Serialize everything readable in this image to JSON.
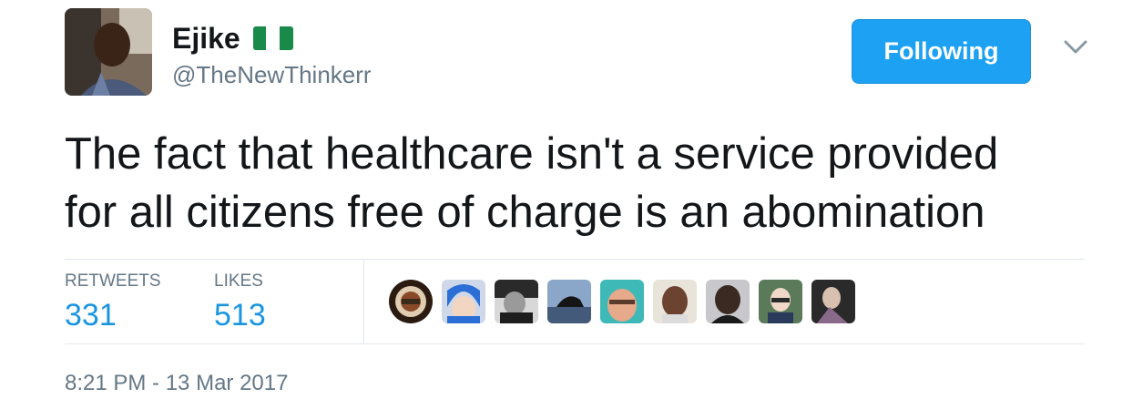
{
  "user": {
    "display_name": "Ejike",
    "handle": "@TheNewThinkerr",
    "flag_colors": [
      "#1a8a4a",
      "#ffffff",
      "#1a8a4a"
    ]
  },
  "follow_button": {
    "label": "Following",
    "color": "#1da1f2"
  },
  "tweet": {
    "text": "The fact that healthcare isn't a service provided\nfor all citizens free of charge is an abomination"
  },
  "stats": {
    "retweets_label": "RETWEETS",
    "retweets_count": "331",
    "likes_label": "LIKES",
    "likes_count": "513"
  },
  "likers_count_shown": 9,
  "timestamp": "8:21 PM - 13 Mar 2017"
}
